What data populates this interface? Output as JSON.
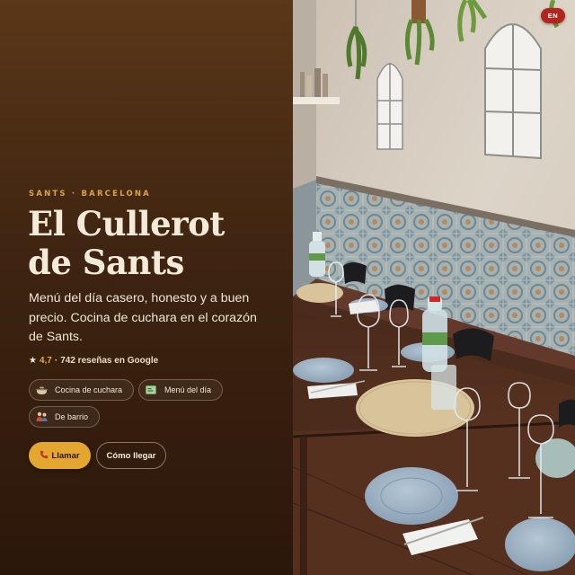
{
  "hero": {
    "eyebrow": "SANTS · BARCELONA",
    "title": "El Cullerot de Sants",
    "title_line1": "El Cullerot",
    "title_line2": "de Sants",
    "description": "Menú del día casero, honesto y a buen precio. Cocina de cuchara en el corazón de Sants."
  },
  "rating": {
    "star": "★",
    "score": "4,7",
    "separator": "·",
    "reviews": "742 reseñas en Google"
  },
  "tags": [
    {
      "icon": "pot-icon",
      "label": "Cocina de cuchara"
    },
    {
      "icon": "menu-card-icon",
      "label": "Menú del día"
    },
    {
      "icon": "people-icon",
      "label": "De barrio"
    }
  ],
  "actions": {
    "call_icon": "phone-icon",
    "call_label": "Llamar",
    "directions_label": "Cómo llegar"
  },
  "language": {
    "current": "EN"
  },
  "colors": {
    "accent": "#e3a72f",
    "eyebrow": "#d9a44a",
    "panel_top": "#5a3718",
    "panel_bottom": "#2b170a",
    "text": "#f4ead8",
    "lang_badge": "#b3261e"
  }
}
